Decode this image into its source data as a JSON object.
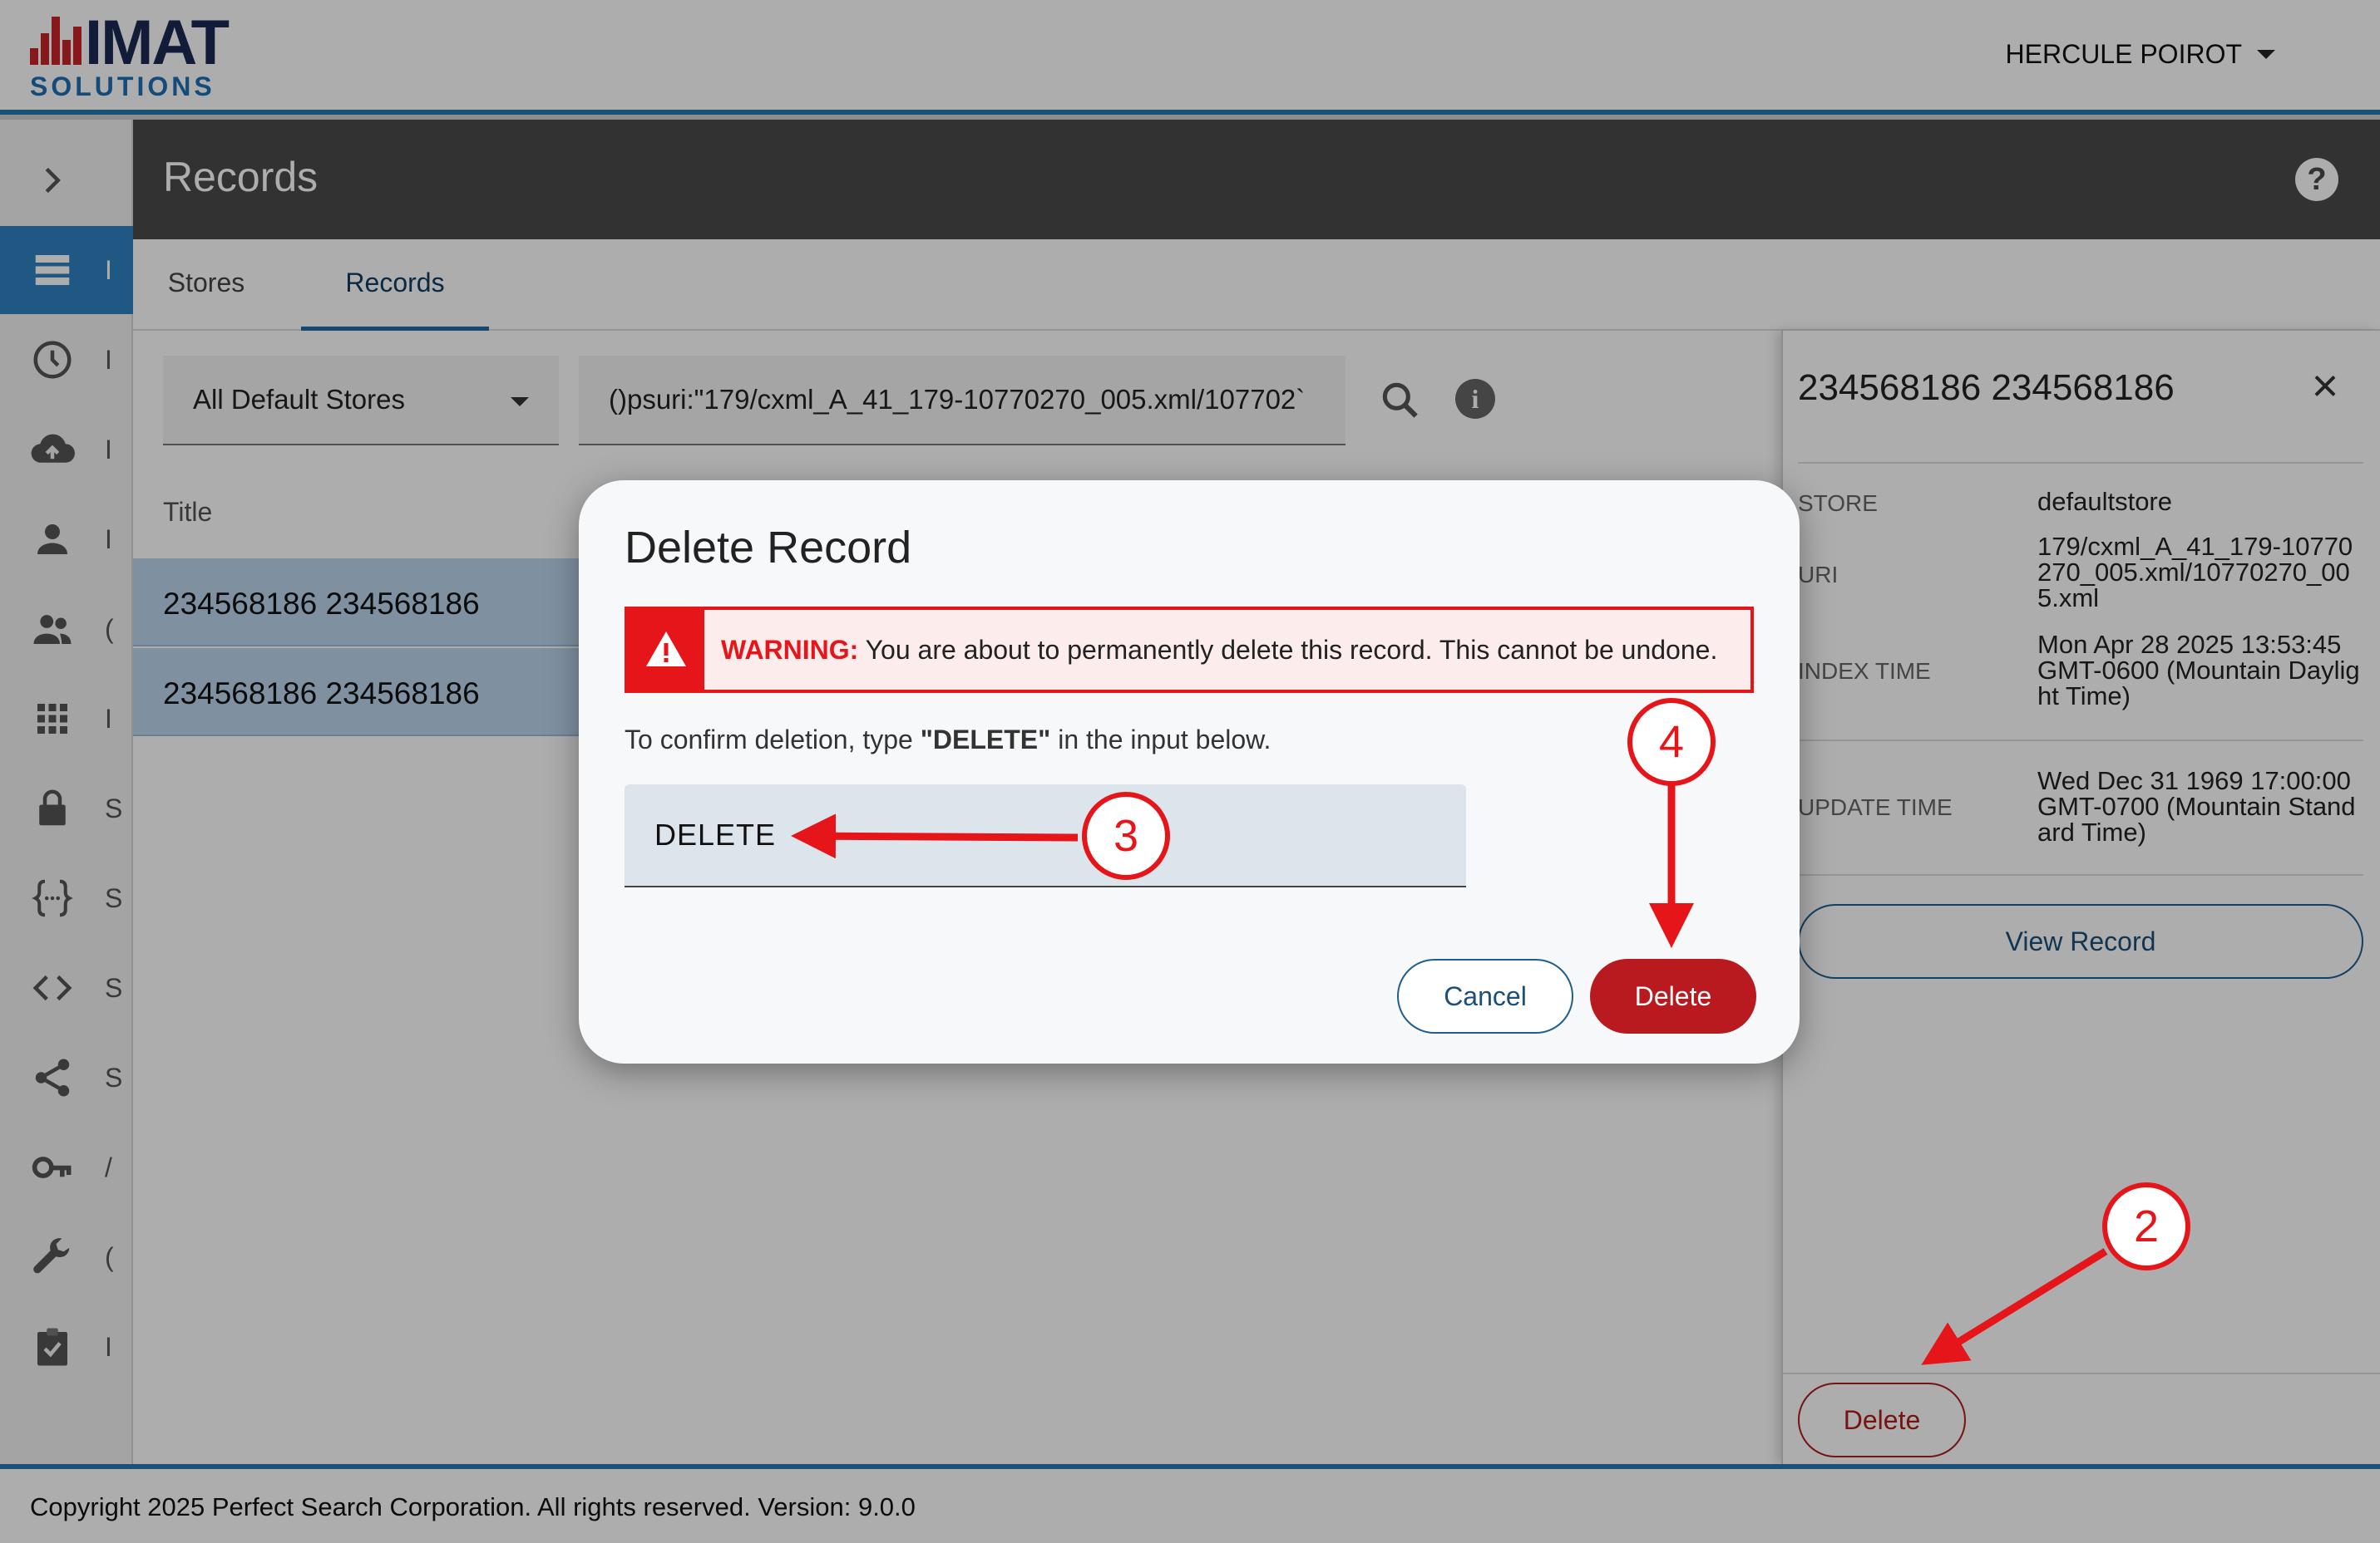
{
  "header": {
    "logo_main": "IMAT",
    "logo_sub": "SOLUTIONS",
    "user_name": "HERCULE POIROT"
  },
  "sidebar": {
    "expand_icon": "chevron-right-icon",
    "items": [
      {
        "icon": "list-icon",
        "cut_label": "I",
        "active": true
      },
      {
        "icon": "clock-icon",
        "cut_label": "I"
      },
      {
        "icon": "cloud-upload-icon",
        "cut_label": "I"
      },
      {
        "icon": "person-icon",
        "cut_label": "I"
      },
      {
        "icon": "people-icon",
        "cut_label": "("
      },
      {
        "icon": "grid-icon",
        "cut_label": "I"
      },
      {
        "icon": "lock-icon",
        "cut_label": "S"
      },
      {
        "icon": "code-braces-icon",
        "cut_label": "S"
      },
      {
        "icon": "code-icon",
        "cut_label": "S"
      },
      {
        "icon": "share-icon",
        "cut_label": "S"
      },
      {
        "icon": "key-icon",
        "cut_label": "/"
      },
      {
        "icon": "wrench-icon",
        "cut_label": "("
      },
      {
        "icon": "clipboard-check-icon",
        "cut_label": "I"
      }
    ]
  },
  "page": {
    "title": "Records"
  },
  "tabs": [
    {
      "label": "Stores"
    },
    {
      "label": "Records",
      "active": true
    }
  ],
  "search": {
    "store_select": "All Default Stores",
    "query": "()psuri:\"179/cxml_A_41_179-10770270_005.xml/107702`"
  },
  "table": {
    "columns": [
      "Title"
    ],
    "rows": [
      {
        "title": "234568186 234568186"
      },
      {
        "title": "234568186 234568186"
      }
    ]
  },
  "detail": {
    "title": "234568186 234568186",
    "fields": [
      {
        "label": "STORE",
        "value": "defaultstore"
      },
      {
        "label": "URI",
        "value": "179/cxml_A_41_179-10770270_005.xml/10770270_005.xml"
      },
      {
        "label": "INDEX TIME",
        "value": "Mon Apr 28 2025 13:53:45 GMT-0600 (Mountain Daylight Time)"
      },
      {
        "label": "UPDATE TIME",
        "value": "Wed Dec 31 1969 17:00:00 GMT-0700 (Mountain Standard Time)"
      }
    ],
    "view_button": "View Record",
    "delete_button": "Delete"
  },
  "dialog": {
    "title": "Delete Record",
    "warning_label": "WARNING:",
    "warning_message": "You are about to permanently delete this record. This cannot be undone.",
    "confirm_prefix": "To confirm deletion, type ",
    "confirm_keyword": "\"DELETE\"",
    "confirm_suffix": " in the input below.",
    "input_value": "DELETE",
    "cancel_button": "Cancel",
    "delete_button": "Delete"
  },
  "callouts": [
    "2",
    "3",
    "4"
  ],
  "colors": {
    "accent": "#2a78ad",
    "danger": "#e5151a",
    "delete_button": "#b81a1f",
    "selected_row": "#bcd6ee",
    "title_bar": "#4a4a4a"
  },
  "footer": {
    "text": "Copyright 2025 Perfect Search Corporation. All rights reserved. Version: 9.0.0"
  }
}
